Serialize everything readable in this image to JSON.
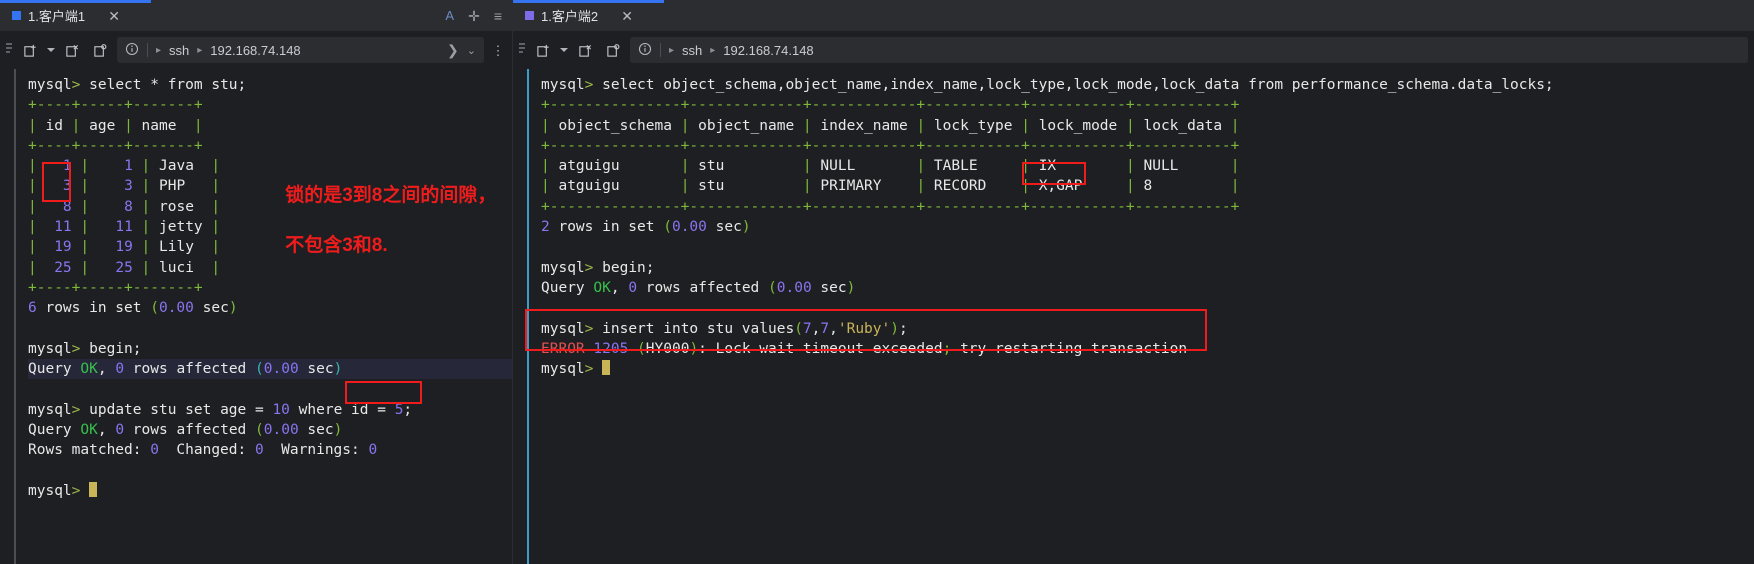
{
  "panes": {
    "left": {
      "tab": {
        "title": "1.客户端1",
        "marker_color": "#3574f0",
        "close": "✕"
      },
      "tab_actions": {
        "font_icon": "A",
        "add_icon": "✛",
        "menu_icon": "≡"
      },
      "toolbar": {
        "new_tab_icon": "new-tab",
        "dropdown_icon": "▾",
        "close_tab_icon": "close-tab",
        "restart_icon": "restart-tab",
        "info_icon": "ⓘ",
        "arrow1": "▸",
        "protocol": "ssh",
        "arrow2": "▸",
        "host": "192.168.74.148",
        "chev_right": "❯",
        "chev_down": "⌄",
        "more_icon": "⋮"
      },
      "terminal_lines": [
        [
          {
            "t": "mysql",
            "c": "wht"
          },
          {
            "t": "> ",
            "c": "prompt-gt"
          },
          {
            "t": "select * from stu;",
            "c": "wht"
          }
        ],
        [
          {
            "t": "+----+-----+-------+",
            "c": "grn"
          }
        ],
        [
          {
            "t": "| ",
            "c": "grn"
          },
          {
            "t": "id",
            "c": "wht"
          },
          {
            "t": " | ",
            "c": "grn"
          },
          {
            "t": "age",
            "c": "wht"
          },
          {
            "t": " | ",
            "c": "grn"
          },
          {
            "t": "name",
            "c": "wht"
          },
          {
            "t": "  |",
            "c": "grn"
          }
        ],
        [
          {
            "t": "+----+-----+-------+",
            "c": "grn"
          }
        ],
        [
          {
            "t": "| ",
            "c": "grn"
          },
          {
            "t": "  1",
            "c": "pur"
          },
          {
            "t": " | ",
            "c": "grn"
          },
          {
            "t": "   1",
            "c": "pur"
          },
          {
            "t": " | ",
            "c": "grn"
          },
          {
            "t": "Java",
            "c": "wht"
          },
          {
            "t": "  |",
            "c": "grn"
          }
        ],
        [
          {
            "t": "| ",
            "c": "grn"
          },
          {
            "t": "  3",
            "c": "pur"
          },
          {
            "t": " | ",
            "c": "grn"
          },
          {
            "t": "   3",
            "c": "pur"
          },
          {
            "t": " | ",
            "c": "grn"
          },
          {
            "t": "PHP",
            "c": "wht"
          },
          {
            "t": "   |",
            "c": "grn"
          }
        ],
        [
          {
            "t": "| ",
            "c": "grn"
          },
          {
            "t": "  8",
            "c": "pur"
          },
          {
            "t": " | ",
            "c": "grn"
          },
          {
            "t": "   8",
            "c": "pur"
          },
          {
            "t": " | ",
            "c": "grn"
          },
          {
            "t": "rose",
            "c": "wht"
          },
          {
            "t": "  |",
            "c": "grn"
          }
        ],
        [
          {
            "t": "| ",
            "c": "grn"
          },
          {
            "t": " 11",
            "c": "pur"
          },
          {
            "t": " | ",
            "c": "grn"
          },
          {
            "t": "  11",
            "c": "pur"
          },
          {
            "t": " | ",
            "c": "grn"
          },
          {
            "t": "jetty",
            "c": "wht"
          },
          {
            "t": " |",
            "c": "grn"
          }
        ],
        [
          {
            "t": "| ",
            "c": "grn"
          },
          {
            "t": " 19",
            "c": "pur"
          },
          {
            "t": " | ",
            "c": "grn"
          },
          {
            "t": "  19",
            "c": "pur"
          },
          {
            "t": " | ",
            "c": "grn"
          },
          {
            "t": "Lily",
            "c": "wht"
          },
          {
            "t": "  |",
            "c": "grn"
          }
        ],
        [
          {
            "t": "| ",
            "c": "grn"
          },
          {
            "t": " 25",
            "c": "pur"
          },
          {
            "t": " | ",
            "c": "grn"
          },
          {
            "t": "  25",
            "c": "pur"
          },
          {
            "t": " | ",
            "c": "grn"
          },
          {
            "t": "luci",
            "c": "wht"
          },
          {
            "t": "  |",
            "c": "grn"
          }
        ],
        [
          {
            "t": "+----+-----+-------+",
            "c": "grn"
          }
        ],
        [
          {
            "t": "6",
            "c": "pur"
          },
          {
            "t": " rows in set ",
            "c": "wht"
          },
          {
            "t": "(",
            "c": "grn"
          },
          {
            "t": "0.00",
            "c": "pur"
          },
          {
            "t": " sec",
            "c": "wht"
          },
          {
            "t": ")",
            "c": "grn"
          }
        ],
        [],
        [
          {
            "t": "mysql",
            "c": "wht"
          },
          {
            "t": "> ",
            "c": "prompt-gt"
          },
          {
            "t": "begin;",
            "c": "wht"
          }
        ],
        [
          {
            "t": "Query ",
            "c": "wht"
          },
          {
            "t": "OK",
            "c": "okgr"
          },
          {
            "t": ", ",
            "c": "wht"
          },
          {
            "t": "0",
            "c": "pur"
          },
          {
            "t": " rows affected ",
            "c": "wht"
          },
          {
            "t": "(",
            "c": "cyn"
          },
          {
            "t": "0.00",
            "c": "pur"
          },
          {
            "t": " sec",
            "c": "wht"
          },
          {
            "t": ")",
            "c": "cyn"
          }
        ],
        [],
        [
          {
            "t": "mysql",
            "c": "wht"
          },
          {
            "t": "> ",
            "c": "prompt-gt"
          },
          {
            "t": "update stu set age = ",
            "c": "wht"
          },
          {
            "t": "10",
            "c": "pur"
          },
          {
            "t": " where ",
            "c": "wht"
          },
          {
            "t": "id = ",
            "c": "wht"
          },
          {
            "t": "5",
            "c": "pur"
          },
          {
            "t": ";",
            "c": "wht"
          }
        ],
        [
          {
            "t": "Query ",
            "c": "wht"
          },
          {
            "t": "OK",
            "c": "okgr"
          },
          {
            "t": ", ",
            "c": "wht"
          },
          {
            "t": "0",
            "c": "pur"
          },
          {
            "t": " rows affected ",
            "c": "wht"
          },
          {
            "t": "(",
            "c": "grn"
          },
          {
            "t": "0.00",
            "c": "pur"
          },
          {
            "t": " sec",
            "c": "wht"
          },
          {
            "t": ")",
            "c": "grn"
          }
        ],
        [
          {
            "t": "Rows matched: ",
            "c": "wht"
          },
          {
            "t": "0",
            "c": "pur"
          },
          {
            "t": "  Changed: ",
            "c": "wht"
          },
          {
            "t": "0",
            "c": "pur"
          },
          {
            "t": "  Warnings: ",
            "c": "wht"
          },
          {
            "t": "0",
            "c": "pur"
          }
        ],
        [],
        [
          {
            "t": "mysql",
            "c": "wht"
          },
          {
            "t": "> ",
            "c": "prompt-gt"
          },
          {
            "t": "",
            "c": "cursor"
          }
        ]
      ],
      "annotation": {
        "text_line1": "锁的是3到8之间的间隙，",
        "text_line2": "不包含3和8.",
        "color": "#f01c1c"
      },
      "highlight_line_index": 14
    },
    "right": {
      "tab": {
        "title": "1.客户端2",
        "marker_color": "#7d6ce8",
        "close": "✕"
      },
      "toolbar": {
        "new_tab_icon": "new-tab",
        "dropdown_icon": "▾",
        "close_tab_icon": "close-tab",
        "restart_icon": "restart-tab",
        "info_icon": "ⓘ",
        "arrow1": "▸",
        "protocol": "ssh",
        "arrow2": "▸",
        "host": "192.168.74.148"
      },
      "terminal_lines": [
        [
          {
            "t": "mysql",
            "c": "wht"
          },
          {
            "t": "> ",
            "c": "prompt-gt"
          },
          {
            "t": "select object_schema,object_name,index_name,lock_type,lock_mode,lock_data from performance_schema.data_locks;",
            "c": "wht"
          }
        ],
        [
          {
            "t": "+---------------+-------------+------------+-----------+-----------+-----------+",
            "c": "grn"
          }
        ],
        [
          {
            "t": "| ",
            "c": "grn"
          },
          {
            "t": "object_schema",
            "c": "wht"
          },
          {
            "t": " | ",
            "c": "grn"
          },
          {
            "t": "object_name",
            "c": "wht"
          },
          {
            "t": " | ",
            "c": "grn"
          },
          {
            "t": "index_name",
            "c": "wht"
          },
          {
            "t": " | ",
            "c": "grn"
          },
          {
            "t": "lock_type",
            "c": "wht"
          },
          {
            "t": " | ",
            "c": "grn"
          },
          {
            "t": "lock_mode",
            "c": "wht"
          },
          {
            "t": " | ",
            "c": "grn"
          },
          {
            "t": "lock_data",
            "c": "wht"
          },
          {
            "t": " |",
            "c": "grn"
          }
        ],
        [
          {
            "t": "+---------------+-------------+------------+-----------+-----------+-----------+",
            "c": "grn"
          }
        ],
        [
          {
            "t": "| ",
            "c": "grn"
          },
          {
            "t": "atguigu      ",
            "c": "wht"
          },
          {
            "t": " | ",
            "c": "grn"
          },
          {
            "t": "stu        ",
            "c": "wht"
          },
          {
            "t": " | ",
            "c": "grn"
          },
          {
            "t": "NULL      ",
            "c": "wht"
          },
          {
            "t": " | ",
            "c": "grn"
          },
          {
            "t": "TABLE    ",
            "c": "wht"
          },
          {
            "t": " | ",
            "c": "grn"
          },
          {
            "t": "IX       ",
            "c": "wht"
          },
          {
            "t": " | ",
            "c": "grn"
          },
          {
            "t": "NULL     ",
            "c": "wht"
          },
          {
            "t": " |",
            "c": "grn"
          }
        ],
        [
          {
            "t": "| ",
            "c": "grn"
          },
          {
            "t": "atguigu      ",
            "c": "wht"
          },
          {
            "t": " | ",
            "c": "grn"
          },
          {
            "t": "stu        ",
            "c": "wht"
          },
          {
            "t": " | ",
            "c": "grn"
          },
          {
            "t": "PRIMARY   ",
            "c": "wht"
          },
          {
            "t": " | ",
            "c": "grn"
          },
          {
            "t": "RECORD   ",
            "c": "wht"
          },
          {
            "t": " | ",
            "c": "grn"
          },
          {
            "t": "X,GAP    ",
            "c": "wht"
          },
          {
            "t": " | ",
            "c": "grn"
          },
          {
            "t": "8        ",
            "c": "wht"
          },
          {
            "t": " |",
            "c": "grn"
          }
        ],
        [
          {
            "t": "+---------------+-------------+------------+-----------+-----------+-----------+",
            "c": "grn"
          }
        ],
        [
          {
            "t": "2",
            "c": "pur"
          },
          {
            "t": " rows in set ",
            "c": "wht"
          },
          {
            "t": "(",
            "c": "grn"
          },
          {
            "t": "0.00",
            "c": "pur"
          },
          {
            "t": " sec",
            "c": "wht"
          },
          {
            "t": ")",
            "c": "grn"
          }
        ],
        [],
        [
          {
            "t": "mysql",
            "c": "wht"
          },
          {
            "t": "> ",
            "c": "prompt-gt"
          },
          {
            "t": "begin;",
            "c": "wht"
          }
        ],
        [
          {
            "t": "Query ",
            "c": "wht"
          },
          {
            "t": "OK",
            "c": "okgr"
          },
          {
            "t": ", ",
            "c": "wht"
          },
          {
            "t": "0",
            "c": "pur"
          },
          {
            "t": " rows affected ",
            "c": "wht"
          },
          {
            "t": "(",
            "c": "grn"
          },
          {
            "t": "0.00",
            "c": "pur"
          },
          {
            "t": " sec",
            "c": "wht"
          },
          {
            "t": ")",
            "c": "grn"
          }
        ],
        [],
        [
          {
            "t": "mysql",
            "c": "wht"
          },
          {
            "t": "> ",
            "c": "prompt-gt"
          },
          {
            "t": "insert into stu values",
            "c": "wht"
          },
          {
            "t": "(",
            "c": "grn"
          },
          {
            "t": "7",
            "c": "pur"
          },
          {
            "t": ",",
            "c": "wht"
          },
          {
            "t": "7",
            "c": "pur"
          },
          {
            "t": ",",
            "c": "wht"
          },
          {
            "t": "'Ruby'",
            "c": "ylw"
          },
          {
            "t": ")",
            "c": "grn"
          },
          {
            "t": ";",
            "c": "wht"
          }
        ],
        [
          {
            "t": "ERROR ",
            "c": "red"
          },
          {
            "t": "1205",
            "c": "pur"
          },
          {
            "t": " (",
            "c": "grn"
          },
          {
            "t": "HY000",
            "c": "wht"
          },
          {
            "t": ")",
            "c": "grn"
          },
          {
            "t": ": Lock wait timeout exceeded",
            "c": "wht"
          },
          {
            "t": "; ",
            "c": "grn"
          },
          {
            "t": "try restarting transaction",
            "c": "wht"
          }
        ],
        [
          {
            "t": "mysql",
            "c": "wht"
          },
          {
            "t": "> ",
            "c": "prompt-gt"
          },
          {
            "t": "",
            "c": "cursor"
          }
        ]
      ]
    }
  },
  "colors": {
    "accent_blue": "#3574f0",
    "accent_purple": "#7d6ce8",
    "annotation_red": "#f01c1c",
    "table_green": "#7fb93c",
    "number_purple": "#8a74f0",
    "background": "#1e1f22",
    "tab_background": "#2b2d30"
  }
}
